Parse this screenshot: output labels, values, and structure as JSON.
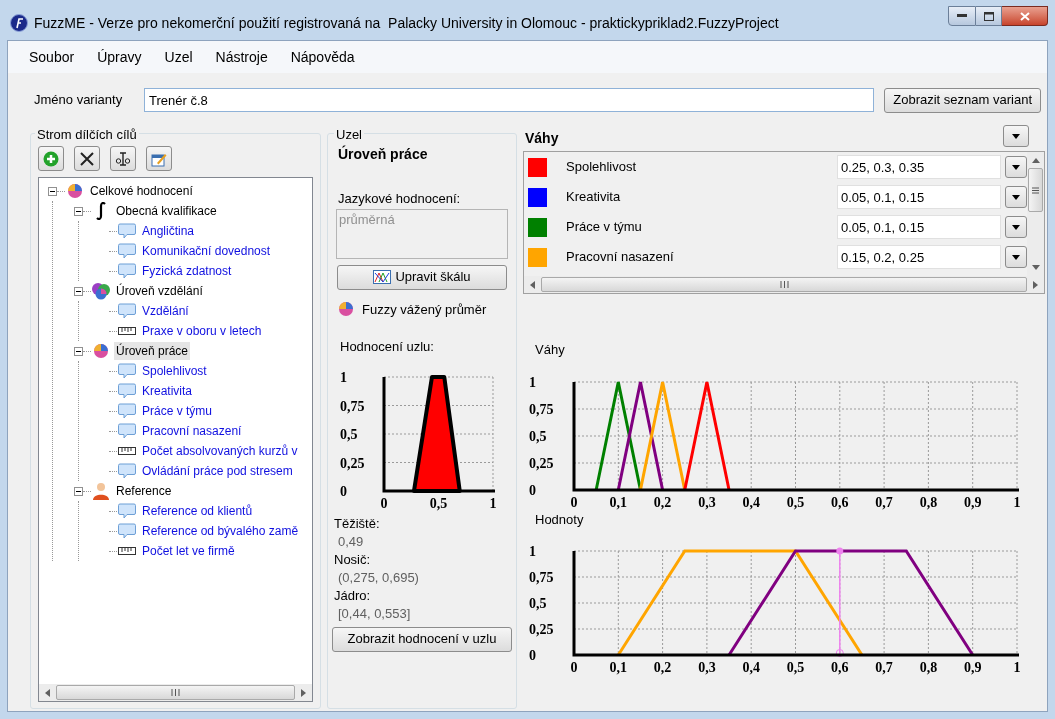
{
  "window": {
    "title": "FuzzME - Verze pro nekomerční použití registrovaná na  Palacky University in Olomouc - praktickypriklad2.FuzzyProject"
  },
  "menu": [
    "Soubor",
    "Úpravy",
    "Uzel",
    "Nástroje",
    "Nápověda"
  ],
  "variant": {
    "label": "Jméno varianty",
    "value": "Trenér č.8",
    "button": "Zobrazit seznam variant"
  },
  "tree_panel": {
    "title": "Strom dílčích cílů",
    "toolbar": [
      {
        "kind": "add"
      },
      {
        "kind": "delete"
      },
      {
        "kind": "rename"
      },
      {
        "kind": "properties"
      }
    ],
    "items": [
      {
        "label": "Celkové hodnocení",
        "kind": "pie",
        "expanded": true,
        "selected": false,
        "children": [
          {
            "label": "Obecná kvalifikace",
            "kind": "integral",
            "expanded": true,
            "selected": false,
            "children": [
              {
                "label": "Angličtina",
                "kind": "speech",
                "selected": false
              },
              {
                "label": "Komunikační dovednost",
                "kind": "speech",
                "selected": false
              },
              {
                "label": "Fyzická zdatnost",
                "kind": "speech",
                "selected": false
              }
            ]
          },
          {
            "label": "Úroveň vzdělání",
            "kind": "multi",
            "expanded": true,
            "selected": false,
            "children": [
              {
                "label": "Vzdělání",
                "kind": "speech",
                "selected": false
              },
              {
                "label": "Praxe v oboru v letech",
                "kind": "ruler",
                "selected": false
              }
            ]
          },
          {
            "label": "Úroveň práce",
            "kind": "pie",
            "expanded": true,
            "selected": true,
            "children": [
              {
                "label": "Spolehlivost",
                "kind": "speech",
                "selected": false
              },
              {
                "label": "Kreativita",
                "kind": "speech",
                "selected": false
              },
              {
                "label": "Práce v týmu",
                "kind": "speech",
                "selected": false
              },
              {
                "label": "Pracovní nasazení",
                "kind": "speech",
                "selected": false
              },
              {
                "label": "Počet absolvovaných kurzů v",
                "kind": "ruler",
                "selected": false
              },
              {
                "label": "Ovládání práce pod stresem",
                "kind": "speech",
                "selected": false
              }
            ]
          },
          {
            "label": "Reference",
            "kind": "person",
            "expanded": true,
            "selected": false,
            "children": [
              {
                "label": "Reference od klientů",
                "kind": "speech",
                "selected": false
              },
              {
                "label": "Reference od bývalého zamě",
                "kind": "speech",
                "selected": false
              },
              {
                "label": "Počet let ve firmě",
                "kind": "ruler",
                "selected": false
              }
            ]
          }
        ]
      }
    ]
  },
  "node_panel": {
    "title": "Uzel",
    "node_name": "Úroveň práce",
    "linguistic_label": "Jazykové hodnocení:",
    "linguistic_value": "průměrná",
    "edit_scale_button": "Upravit škálu",
    "method": "Fuzzy vážený průměr",
    "evaluation_label": "Hodnocení uzlu:",
    "chart_data": {
      "type": "area",
      "x": [
        0.275,
        0.44,
        0.553,
        0.695
      ],
      "series": [
        {
          "color": "#ff0000",
          "values": [
            0,
            1,
            1,
            0
          ]
        }
      ],
      "xlim": [
        0,
        1
      ],
      "ylim": [
        0,
        1
      ],
      "grid": true,
      "xticks": [
        {
          "value": 0,
          "label": "0"
        },
        {
          "value": 0.5,
          "label": "0,5"
        },
        {
          "value": 1,
          "label": "1"
        }
      ],
      "yticks": [
        {
          "value": 0,
          "label": "0"
        },
        {
          "value": 0.25,
          "label": "0,25"
        },
        {
          "value": 0.5,
          "label": "0,5"
        },
        {
          "value": 0.75,
          "label": "0,75"
        },
        {
          "value": 1,
          "label": "1"
        }
      ]
    },
    "stats": [
      {
        "label": "Těžiště:",
        "value": "0,49"
      },
      {
        "label": "Nosič:",
        "value": "(0,275, 0,695)"
      },
      {
        "label": "Jádro:",
        "value": "[0,44, 0,553]"
      }
    ],
    "show_button": "Zobrazit hodnocení v uzlu"
  },
  "weights": {
    "title": "Váhy",
    "rows": [
      {
        "name": "Spolehlivost",
        "value": "0.25, 0.3, 0.35",
        "color": "#ff0000"
      },
      {
        "name": "Kreativita",
        "value": "0.05, 0.1, 0.15",
        "color": "#0000ff"
      },
      {
        "name": "Práce v týmu",
        "value": "0.05, 0.1, 0.15",
        "color": "#008000"
      },
      {
        "name": "Pracovní nasazení",
        "value": "0.15, 0.2, 0.25",
        "color": "#ffa500"
      }
    ]
  },
  "charts": [
    {
      "title": "Váhy",
      "chart_data": {
        "type": "line",
        "x": [
          0.05,
          0.1,
          0.15,
          0.2,
          0.25,
          0.3,
          0.35
        ],
        "series": [
          {
            "color": "#008000",
            "values": [
              0,
              1,
              0,
              null,
              null,
              null,
              null
            ]
          },
          {
            "color": "#800080",
            "values": [
              null,
              0,
              1,
              0,
              null,
              null,
              null
            ]
          },
          {
            "color": "#ffa500",
            "values": [
              null,
              null,
              0,
              1,
              0,
              null,
              null
            ]
          },
          {
            "color": "#ff0000",
            "values": [
              null,
              null,
              null,
              null,
              0,
              1,
              0
            ]
          }
        ],
        "xlim": [
          0,
          1
        ],
        "ylim": [
          0,
          1
        ],
        "grid": true,
        "xticks": [
          {
            "value": 0,
            "label": "0"
          },
          {
            "value": 0.1,
            "label": "0,1"
          },
          {
            "value": 0.2,
            "label": "0,2"
          },
          {
            "value": 0.3,
            "label": "0,3"
          },
          {
            "value": 0.4,
            "label": "0,4"
          },
          {
            "value": 0.5,
            "label": "0,5"
          },
          {
            "value": 0.6,
            "label": "0,6"
          },
          {
            "value": 0.7,
            "label": "0,7"
          },
          {
            "value": 0.8,
            "label": "0,8"
          },
          {
            "value": 0.9,
            "label": "0,9"
          },
          {
            "value": 1,
            "label": "1"
          }
        ],
        "yticks": [
          {
            "value": 0,
            "label": "0"
          },
          {
            "value": 0.25,
            "label": "0,25"
          },
          {
            "value": 0.5,
            "label": "0,5"
          },
          {
            "value": 0.75,
            "label": "0,75"
          },
          {
            "value": 1,
            "label": "1"
          }
        ]
      }
    },
    {
      "title": "Hodnoty",
      "chart_data": {
        "type": "line",
        "x": [
          0.1,
          0.25,
          0.35,
          0.5,
          0.65,
          0.75,
          0.9
        ],
        "series": [
          {
            "color": "#ffa500",
            "values": [
              0,
              1,
              1,
              1,
              0,
              null,
              null
            ]
          },
          {
            "color": "#800080",
            "values": [
              null,
              null,
              0,
              1,
              1,
              1,
              0
            ]
          }
        ],
        "xlim": [
          0,
          1
        ],
        "ylim": [
          0,
          1
        ],
        "grid": true,
        "xticks": [
          {
            "value": 0,
            "label": "0"
          },
          {
            "value": 0.1,
            "label": "0,1"
          },
          {
            "value": 0.2,
            "label": "0,2"
          },
          {
            "value": 0.3,
            "label": "0,3"
          },
          {
            "value": 0.4,
            "label": "0,4"
          },
          {
            "value": 0.5,
            "label": "0,5"
          },
          {
            "value": 0.6,
            "label": "0,6"
          },
          {
            "value": 0.7,
            "label": "0,7"
          },
          {
            "value": 0.8,
            "label": "0,8"
          },
          {
            "value": 0.9,
            "label": "0,9"
          },
          {
            "value": 1,
            "label": "1"
          }
        ],
        "yticks": [
          {
            "value": 0,
            "label": "0"
          },
          {
            "value": 0.25,
            "label": "0,25"
          },
          {
            "value": 0.5,
            "label": "0,5"
          },
          {
            "value": 0.75,
            "label": "0,75"
          },
          {
            "value": 1,
            "label": "1"
          }
        ],
        "ref_lines": [
          {
            "axis": "x",
            "value": 0.6,
            "color": "#ee82ee"
          }
        ]
      }
    }
  ]
}
